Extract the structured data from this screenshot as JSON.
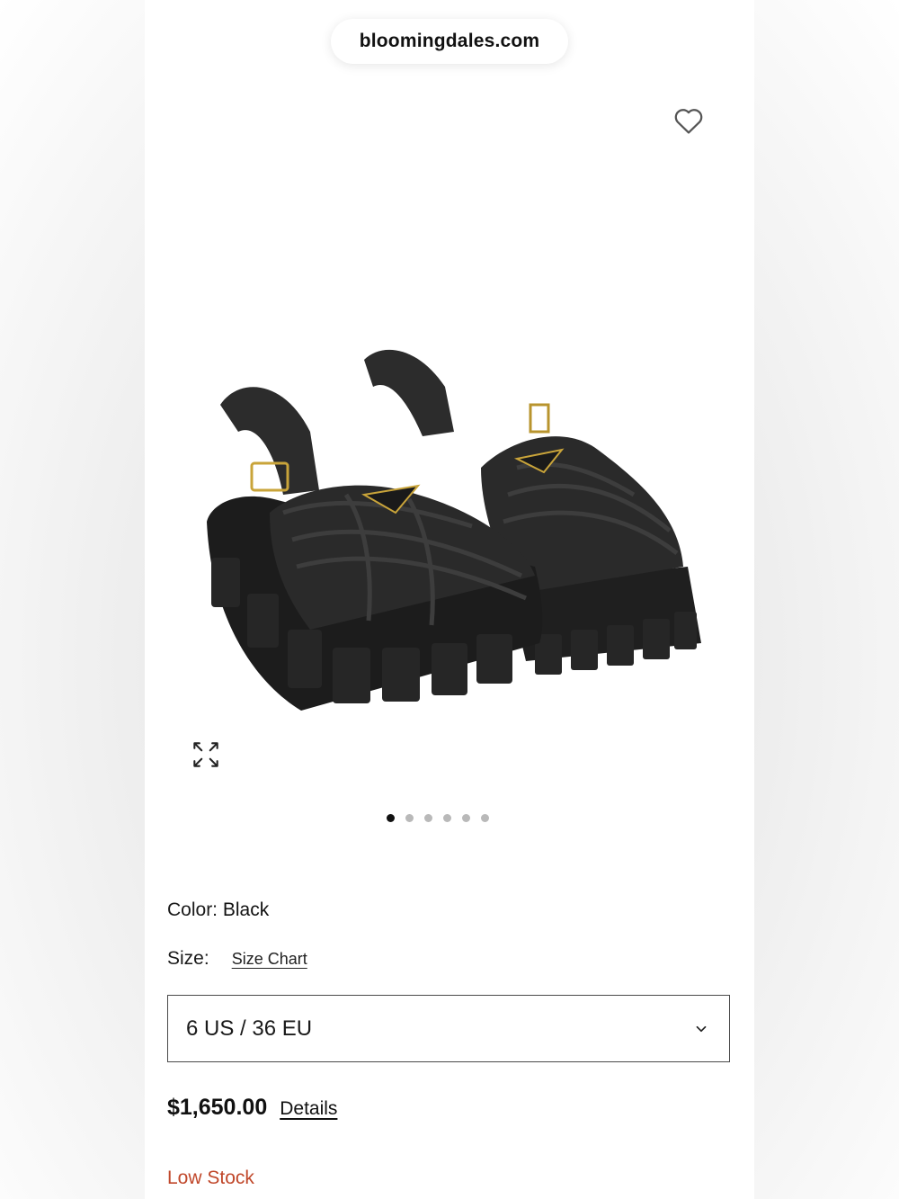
{
  "browser": {
    "url": "bloomingdales.com"
  },
  "product": {
    "image_alt": "Black crochet platform fisherman sandals with gold triangle logo",
    "color_label": "Color:",
    "color_value": "Black",
    "size_label": "Size:",
    "size_chart_link": "Size Chart",
    "selected_size": "6 US / 36 EU",
    "price": "$1,650.00",
    "details_link": "Details",
    "stock_status": "Low Stock"
  },
  "carousel": {
    "total_images": 6,
    "active_index": 0
  },
  "icons": {
    "favorite": "heart-icon",
    "expand": "expand-icon",
    "dropdown": "chevron-down-icon"
  },
  "colors": {
    "stock_status": "#c0472a",
    "active_dot": "#111111",
    "inactive_dot": "#b9b9b9"
  }
}
